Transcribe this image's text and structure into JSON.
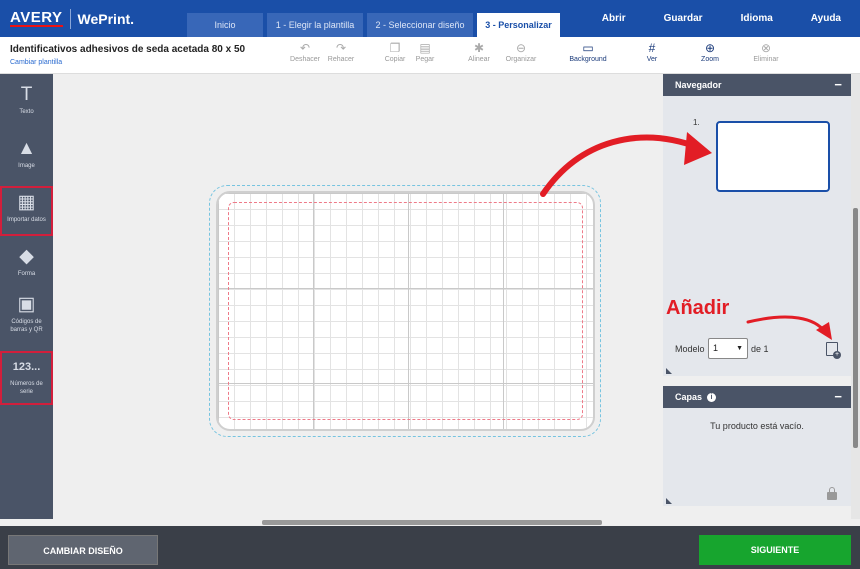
{
  "brand": {
    "avery": "AVERY",
    "weprint": "WePrint."
  },
  "steps": [
    {
      "label": "Inicio",
      "active": false
    },
    {
      "label": "1 - Elegir la plantilla",
      "active": false
    },
    {
      "label": "2 - Seleccionar diseño",
      "active": false
    },
    {
      "label": "3 - Personalizar",
      "active": true
    }
  ],
  "topmenu": [
    "Abrir",
    "Guardar",
    "Idioma",
    "Ayuda"
  ],
  "document": {
    "title": "Identificativos adhesivos de seda acetada 80 x 50",
    "change_template": "Cambiar plantilla"
  },
  "tools": {
    "undo": {
      "label": "Deshacer",
      "icon": "undo-icon"
    },
    "redo": {
      "label": "Rehacer",
      "icon": "redo-icon"
    },
    "copy": {
      "label": "Copiar",
      "icon": "copy-icon"
    },
    "paste": {
      "label": "Pegar",
      "icon": "paste-icon"
    },
    "align": {
      "label": "Alinear",
      "icon": "align-icon"
    },
    "arrange": {
      "label": "Organizar",
      "icon": "arrange-icon"
    },
    "background": {
      "label": "Background",
      "icon": "background-icon"
    },
    "view": {
      "label": "Ver",
      "icon": "grid-icon"
    },
    "zoom": {
      "label": "Zoom",
      "icon": "zoom-icon"
    },
    "delete": {
      "label": "Eliminar",
      "icon": "delete-icon"
    }
  },
  "sidebar": [
    {
      "label": "Texto",
      "icon": "text-icon",
      "glyph": "T",
      "highlighted": false
    },
    {
      "label": "Image",
      "icon": "image-icon",
      "glyph": "▲",
      "highlighted": false
    },
    {
      "label": "Importar datos",
      "icon": "table-icon",
      "glyph": "▦",
      "highlighted": true
    },
    {
      "label": "Forma",
      "icon": "shapes-icon",
      "glyph": "◆",
      "highlighted": false
    },
    {
      "label": "Códigos de barras y QR",
      "icon": "qr-icon",
      "glyph": "▣",
      "highlighted": false
    },
    {
      "label": "Números de serie",
      "icon": "serial-icon",
      "glyph": "123...",
      "highlighted": true
    }
  ],
  "navigator": {
    "title": "Navegador",
    "page_number": "1.",
    "modelo_label": "Modelo",
    "modelo_value": "1",
    "of_label": "de 1"
  },
  "annotation": {
    "add_label": "Añadir",
    "color": "#e21d25"
  },
  "layers": {
    "title": "Capas",
    "empty_text": "Tu producto está vacío."
  },
  "footer": {
    "change_design": "CAMBIAR DISEÑO",
    "next": "SIGUIENTE"
  },
  "colors": {
    "header": "#1a4fa8",
    "sidebar": "#4a5467",
    "next_button": "#17a52e",
    "highlight": "#d21f3c"
  }
}
